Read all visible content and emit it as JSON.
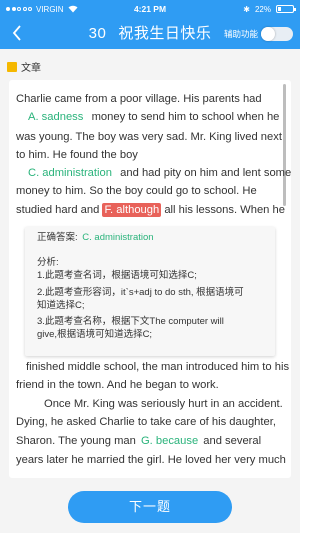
{
  "status_bar": {
    "carrier": "VIRGIN",
    "time": "4:21 PM",
    "battery": "22%"
  },
  "header": {
    "number": "30",
    "title": "祝我生日快乐",
    "assist_label": "辅助功能",
    "assist_enabled": false,
    "accent_color": "#2f9cf3"
  },
  "section": {
    "label": "文章"
  },
  "passage": {
    "l1": "Charlie came from a poor village. His parents had",
    "l2_choice": "A. sadness",
    "l2_text": "money to send him to school when he",
    "l3": "was young. The boy was very sad. Mr. King lived next",
    "l4": "to him. He found the boy",
    "l5_choice": "C. administration",
    "l5_text": "and had pity on him and lent some",
    "l6": "money to him. So the boy could go to school. He",
    "l7_pre": "studied hard and",
    "l7_choice": "F. although",
    "l7_post": "all his lessons. When he",
    "l8": "finished middle school, the man introduced him to his",
    "l9": "friend in the town. And he began to work.",
    "l10": "Once Mr. King was seriously hurt in an accident.",
    "l11": "Dying, he asked Charlie to take care of his daughter,",
    "l12_pre": "Sharon. The young man",
    "l12_choice": "G. because",
    "l12_post": "and several",
    "l13": "years later he married the girl. He loved her very much"
  },
  "explanation": {
    "correct_label": "正确答案:",
    "correct_answer": "C. administration",
    "analysis_label": "分析:",
    "p1": "1.此题考查名词，根据语境可知选择C;",
    "p2a": "2.此题考查形容词，it`s+adj to do sth, 根据语境可",
    "p2b": "知道选择C;",
    "p3a": "3.此题考查名称，根据下文The computer will",
    "p3b": "give,根据语境可知道选择C;"
  },
  "footer": {
    "next_label": "下一题"
  }
}
